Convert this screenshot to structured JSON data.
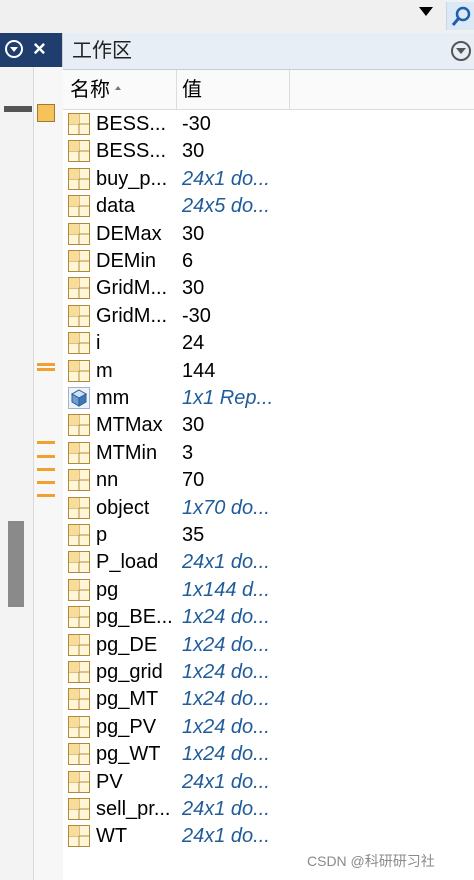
{
  "workspace": {
    "title": "工作区",
    "columns": {
      "name": "名称",
      "value": "值"
    },
    "variables": [
      {
        "name": "BESS...",
        "value": "-30",
        "italic": false,
        "icon": "matrix-icon"
      },
      {
        "name": "BESS...",
        "value": "30",
        "italic": false,
        "icon": "matrix-icon"
      },
      {
        "name": "buy_p...",
        "value": "24x1 do...",
        "italic": true,
        "icon": "matrix-icon"
      },
      {
        "name": "data",
        "value": "24x5 do...",
        "italic": true,
        "icon": "matrix-icon"
      },
      {
        "name": "DEMax",
        "value": "30",
        "italic": false,
        "icon": "matrix-icon"
      },
      {
        "name": "DEMin",
        "value": "6",
        "italic": false,
        "icon": "matrix-icon"
      },
      {
        "name": "GridM...",
        "value": "30",
        "italic": false,
        "icon": "matrix-icon"
      },
      {
        "name": "GridM...",
        "value": "-30",
        "italic": false,
        "icon": "matrix-icon"
      },
      {
        "name": "i",
        "value": "24",
        "italic": false,
        "icon": "matrix-icon"
      },
      {
        "name": "m",
        "value": "144",
        "italic": false,
        "icon": "matrix-icon"
      },
      {
        "name": "mm",
        "value": "1x1 Rep...",
        "italic": true,
        "icon": "object-cube-icon"
      },
      {
        "name": "MTMax",
        "value": "30",
        "italic": false,
        "icon": "matrix-icon"
      },
      {
        "name": "MTMin",
        "value": "3",
        "italic": false,
        "icon": "matrix-icon"
      },
      {
        "name": "nn",
        "value": "70",
        "italic": false,
        "icon": "matrix-icon"
      },
      {
        "name": "object",
        "value": "1x70 do...",
        "italic": true,
        "icon": "matrix-icon"
      },
      {
        "name": "p",
        "value": "35",
        "italic": false,
        "icon": "matrix-icon"
      },
      {
        "name": "P_load",
        "value": "24x1 do...",
        "italic": true,
        "icon": "matrix-icon"
      },
      {
        "name": "pg",
        "value": "1x144 d...",
        "italic": true,
        "icon": "matrix-icon"
      },
      {
        "name": "pg_BE...",
        "value": "1x24 do...",
        "italic": true,
        "icon": "matrix-icon"
      },
      {
        "name": "pg_DE",
        "value": "1x24 do...",
        "italic": true,
        "icon": "matrix-icon"
      },
      {
        "name": "pg_grid",
        "value": "1x24 do...",
        "italic": true,
        "icon": "matrix-icon"
      },
      {
        "name": "pg_MT",
        "value": "1x24 do...",
        "italic": true,
        "icon": "matrix-icon"
      },
      {
        "name": "pg_PV",
        "value": "1x24 do...",
        "italic": true,
        "icon": "matrix-icon"
      },
      {
        "name": "pg_WT",
        "value": "1x24 do...",
        "italic": true,
        "icon": "matrix-icon"
      },
      {
        "name": "PV",
        "value": "24x1 do...",
        "italic": true,
        "icon": "matrix-icon"
      },
      {
        "name": "sell_pr...",
        "value": "24x1 do...",
        "italic": true,
        "icon": "matrix-icon"
      },
      {
        "name": "WT",
        "value": "24x1 do...",
        "italic": true,
        "icon": "matrix-icon"
      }
    ]
  },
  "left_panel": {
    "close_label": "×"
  },
  "icons": {
    "top_dropdown": "caret-down-icon",
    "search": "search-icon",
    "panel_menu": "panel-menu-icon"
  },
  "colors": {
    "panel_header": "#1f3e6e",
    "value_italic": "#1f5c99",
    "marker": "#f0a030"
  },
  "watermark": "CSDN @科研研习社"
}
